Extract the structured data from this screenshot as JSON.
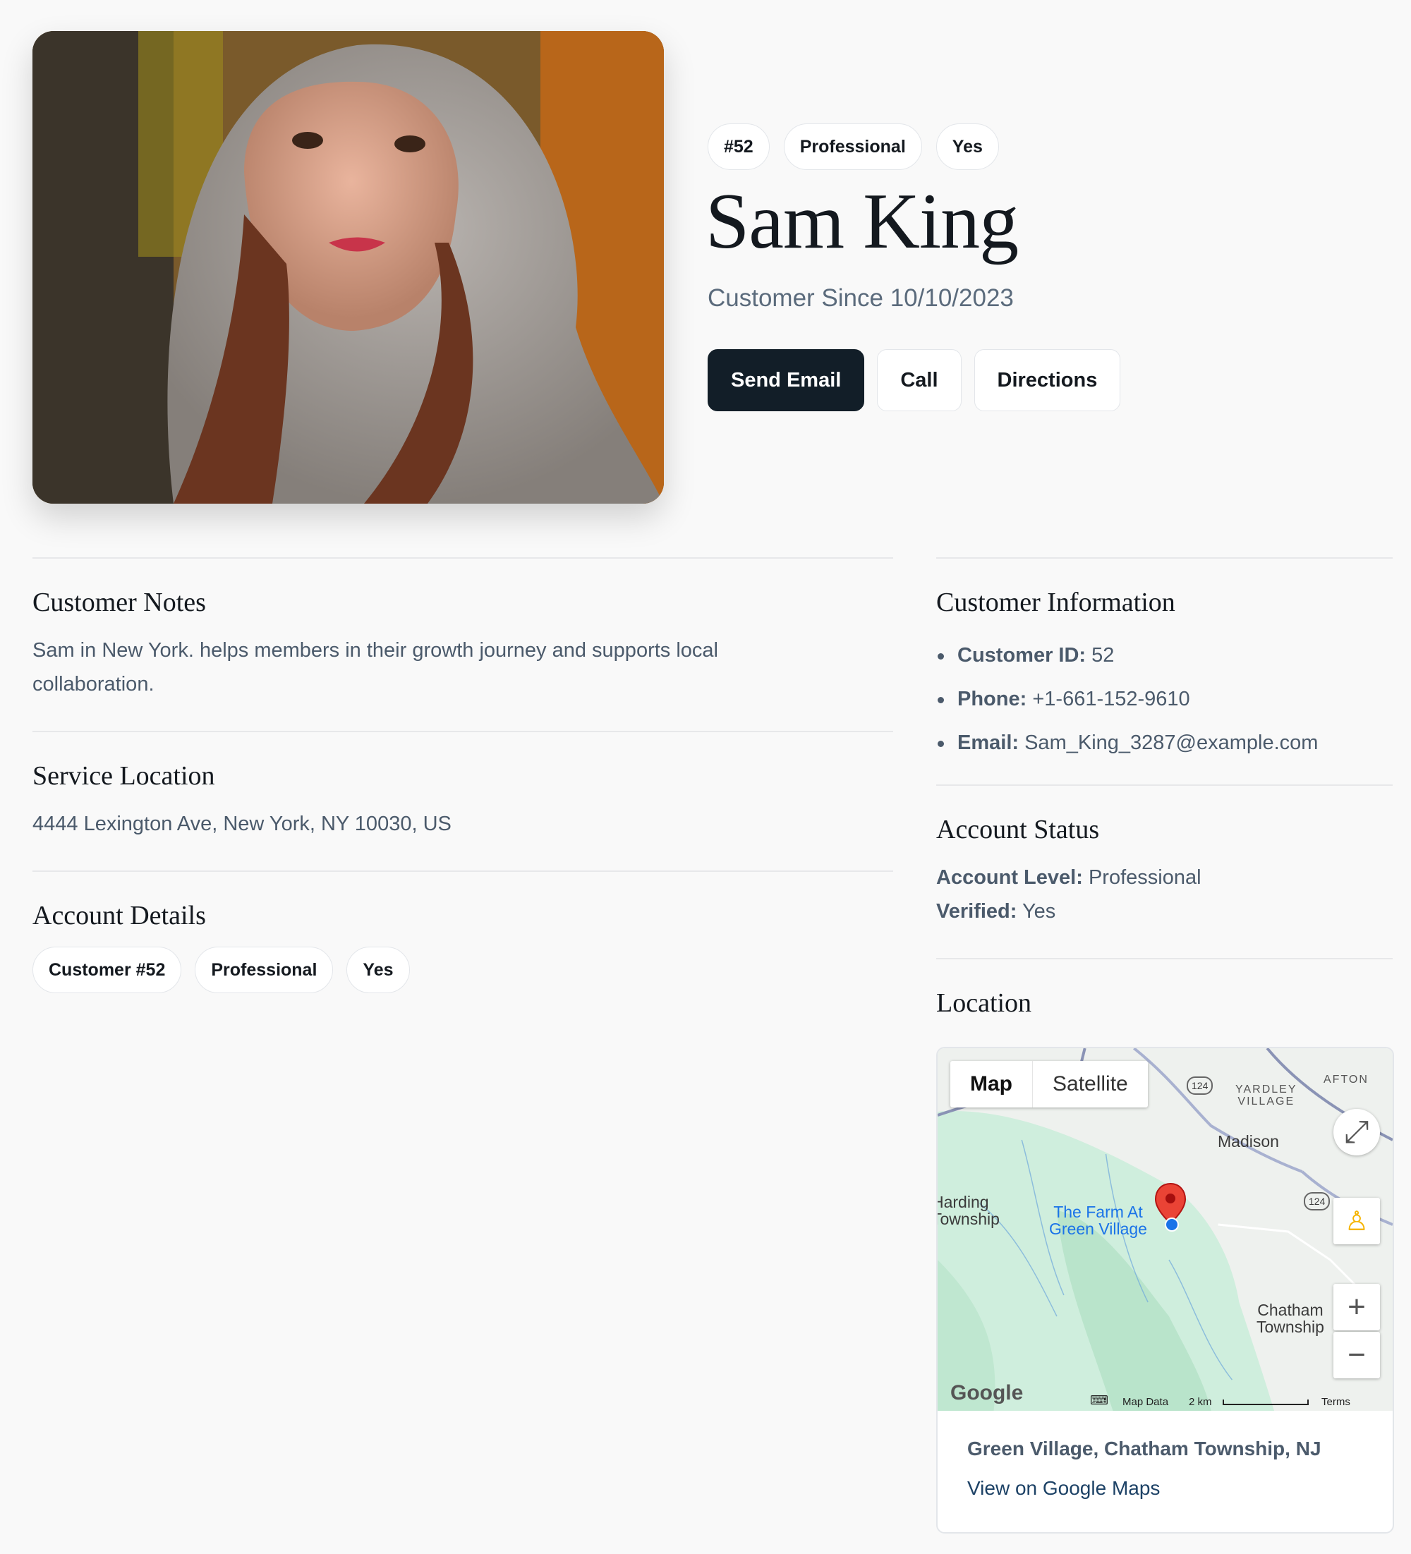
{
  "header": {
    "badges": [
      "#52",
      "Professional",
      "Yes"
    ],
    "name": "Sam King",
    "since": "Customer Since 10/10/2023",
    "actions": {
      "send_email": "Send Email",
      "call": "Call",
      "directions": "Directions"
    }
  },
  "notes": {
    "title": "Customer Notes",
    "text": "Sam in New York. helps members in their growth journey and supports local collaboration."
  },
  "service_location": {
    "title": "Service Location",
    "address": "4444 Lexington Ave, New York, NY 10030, US"
  },
  "account_details": {
    "title": "Account Details",
    "pills": [
      "Customer #52",
      "Professional",
      "Yes"
    ]
  },
  "customer_info": {
    "title": "Customer Information",
    "items": [
      {
        "label": "Customer ID:",
        "value": "52"
      },
      {
        "label": "Phone:",
        "value": "+1-661-152-9610"
      },
      {
        "label": "Email:",
        "value": "Sam_King_3287@example.com"
      }
    ]
  },
  "account_status": {
    "title": "Account Status",
    "level_label": "Account Level:",
    "level_value": "Professional",
    "verified_label": "Verified:",
    "verified_value": "Yes"
  },
  "location": {
    "title": "Location",
    "map": {
      "tab_map": "Map",
      "tab_satellite": "Satellite",
      "labels": {
        "yardley": "YARDLEY\nVILLAGE",
        "afton": "AFTON",
        "madison": "Madison",
        "harding": "Harding\nTownship",
        "farm": "The Farm At\nGreen Village",
        "chatham": "Chatham\nTownship",
        "route_124a": "124",
        "route_124b": "124"
      },
      "google": "Google",
      "map_data": "Map Data",
      "scale": "2 km",
      "terms": "Terms"
    },
    "place": "Green Village, Chatham Township, NJ",
    "link": "View on Google Maps"
  },
  "colors": {
    "primary_button": "#121e28",
    "page_bg": "#f9f9f9",
    "marker": "#ea4335"
  }
}
